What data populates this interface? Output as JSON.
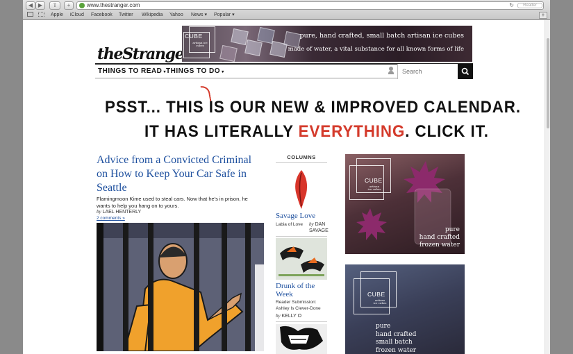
{
  "browser": {
    "url": "www.thestranger.com",
    "reader_label": "Reader",
    "bookmarks": [
      "Apple",
      "iCloud",
      "Facebook",
      "Twitter",
      "Wikipedia",
      "Yahoo",
      "News ▾",
      "Popular ▾"
    ]
  },
  "site": {
    "logo": "theStranger"
  },
  "banner_ad": {
    "brand": "CUBE",
    "brand_sub": "artisan ice cubes",
    "line1": "pure, hand crafted, small batch artisan ice cubes",
    "line2": "made of water, a vital substance for all known forms of life"
  },
  "nav": {
    "things_to_read": "THINGS TO READ",
    "things_to_do": "THINGS TO DO",
    "search_placeholder": "Search"
  },
  "promo": {
    "line1_a": "PSST... THIS",
    "line1_b": "IS OUR NEW & IMPROVED CALENDAR.",
    "line2_a": "IT HAS LITERALLY",
    "line2_red": "EVERYTHING",
    "line2_b": ". CLICK IT."
  },
  "story": {
    "title": "Advice from a Convicted Criminal on How to Keep Your Car Safe in Seattle",
    "dek": "Flamingmoon Kime used to steal cars. Now that he's in prison, he wants to help you hang on to yours.",
    "by": "by",
    "author": "LAEL HENTERLY",
    "comments": "2 comments »"
  },
  "columns": {
    "heading": "COLUMNS",
    "items": [
      {
        "title": "Savage Love",
        "sub": "Labia of Love",
        "by": "by",
        "author": "DAN SAVAGE"
      },
      {
        "title": "Drunk of the Week",
        "sub": "Reader Submission: Ashley Is Clever-Done",
        "by": "by",
        "author": "KELLY O"
      }
    ]
  },
  "side_ads": [
    {
      "brand": "CUBE",
      "brand_sub": "artisan ice cubes",
      "copy": [
        "pure",
        "hand crafted",
        "frozen water"
      ]
    },
    {
      "brand": "CUBE",
      "brand_sub": "artisan ice cubes",
      "copy": [
        "pure",
        "hand crafted",
        "small batch",
        "frozen water"
      ]
    }
  ]
}
